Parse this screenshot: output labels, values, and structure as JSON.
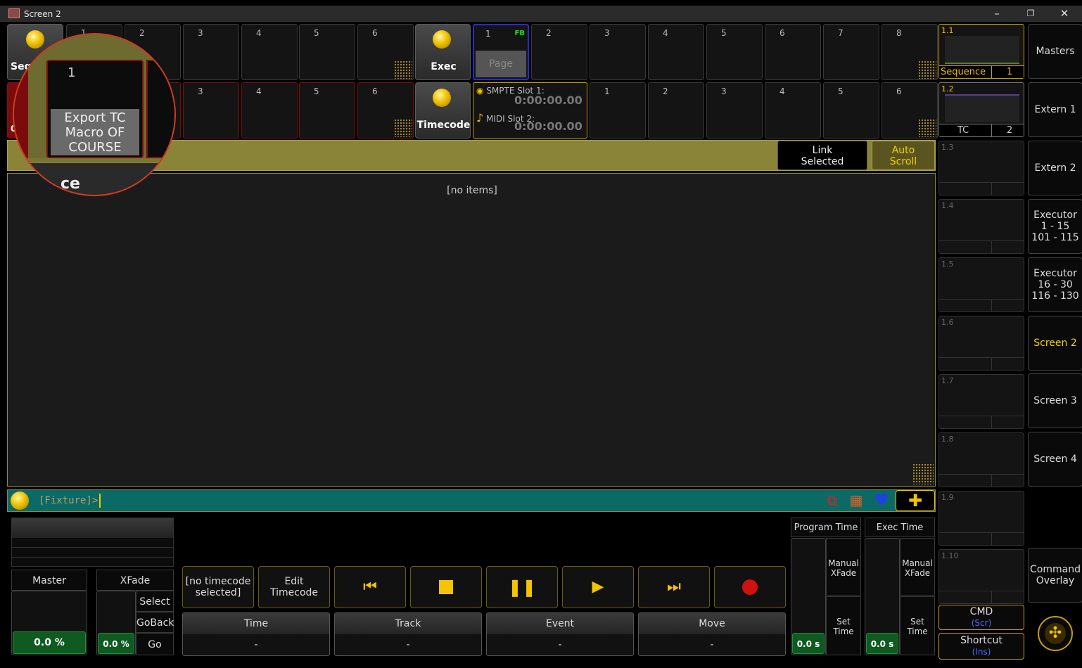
{
  "window": {
    "title": "Screen 2",
    "minimize": "–",
    "restore": "❐",
    "close": "✕"
  },
  "executors": {
    "sequence_label": "Seq",
    "row1_numbers": [
      "1",
      "2",
      "3",
      "4",
      "5",
      "6"
    ],
    "row2_numbers": [
      "3",
      "4",
      "5",
      "6"
    ],
    "row2_partial": "0"
  },
  "exec_button": "Exec",
  "timecode_button": "Timecode",
  "page": {
    "num": "1",
    "fb": "FB",
    "label": "Page"
  },
  "pages_row1": [
    "2",
    "3",
    "4",
    "5",
    "6",
    "7",
    "8"
  ],
  "pages_row2": [
    "1",
    "2",
    "3",
    "4",
    "5",
    "6"
  ],
  "timecode_slots": [
    {
      "label": "SMPTE Slot 1:",
      "time": "0:00:00.00"
    },
    {
      "label": "MIDI Slot 2:",
      "time": "0:00:00.00"
    }
  ],
  "magnifier": {
    "num": "1",
    "text_line1": "Export TC",
    "text_line2": "Macro OF",
    "text_line3": "COURSE",
    "partial": "ce"
  },
  "link_selected": "Link\nSelected",
  "auto_scroll": "Auto\nScroll",
  "no_items": "[no items]",
  "command_line": "[Fixture]>",
  "preview": {
    "p1": {
      "label": "1.1",
      "sub": "Sequence",
      "num": "1"
    },
    "p2": {
      "label": "1.2",
      "sub": "TC",
      "num": "2"
    },
    "others": [
      "1.3",
      "1.4",
      "1.5",
      "1.6",
      "1.7",
      "1.8",
      "1.9",
      "1.10"
    ]
  },
  "views": [
    {
      "label": "Masters",
      "active": false
    },
    {
      "label": "Extern 1",
      "active": false
    },
    {
      "label": "Extern 2",
      "active": false
    },
    {
      "label": "Executor\n1 - 15\n101 - 115",
      "active": false
    },
    {
      "label": "Executor\n16 - 30\n116 - 130",
      "active": false
    },
    {
      "label": "Screen 2",
      "active": true
    },
    {
      "label": "Screen 3",
      "active": false
    },
    {
      "label": "Screen 4",
      "active": false
    },
    {
      "label": "",
      "active": false
    },
    {
      "label": "Command\nOverlay",
      "active": false
    }
  ],
  "cmd_button": {
    "label": "CMD",
    "key": "(Scr)"
  },
  "shortcut_button": {
    "label": "Shortcut",
    "key": "(Ins)"
  },
  "masters": {
    "master_label": "Master",
    "master_value": "0.0 %",
    "xfade_label": "XFade",
    "xfade_value": "0.0 %",
    "select": "Select",
    "goback": "GoBack",
    "go": "Go"
  },
  "timecode_controls": {
    "no_timecode": "[no timecode\nselected]",
    "edit": "Edit\nTimecode"
  },
  "tc_info": [
    {
      "label": "Time",
      "value": "-"
    },
    {
      "label": "Track",
      "value": "-"
    },
    {
      "label": "Event",
      "value": "-"
    },
    {
      "label": "Move",
      "value": "-"
    }
  ],
  "program_time": {
    "label": "Program Time",
    "manual": "Manual\nXFade",
    "set": "Set\nTime",
    "value": "0.0 s"
  },
  "exec_time": {
    "label": "Exec Time",
    "manual": "Manual\nXFade",
    "set": "Set\nTime",
    "value": "0.0 s"
  },
  "colors": {
    "accent": "#f5c400",
    "teal": "#0c6a66",
    "olive": "#8a8438",
    "red": "#d21010"
  }
}
